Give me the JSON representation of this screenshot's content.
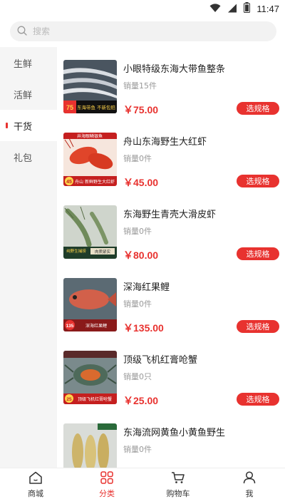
{
  "status": {
    "time": "11:47"
  },
  "search": {
    "placeholder": "搜索"
  },
  "sidebar": {
    "items": [
      {
        "label": "生鲜"
      },
      {
        "label": "活鲜"
      },
      {
        "label": "干货"
      },
      {
        "label": "礼包"
      }
    ],
    "active_index": 2
  },
  "products": [
    {
      "title": "小眼特级东海大带鱼整条",
      "sales": "销量15件",
      "price": "￥75.00",
      "button": "选规格",
      "thumb": {
        "badge": "75",
        "caption": "东海带鱼 不新包赔"
      }
    },
    {
      "title": "舟山东海野生大红虾",
      "sales": "销量0件",
      "price": "￥45.00",
      "button": "选规格",
      "thumb": {
        "badge": "45",
        "caption": "舟山 新鲜野生大红虾",
        "top": "井海眼鳞银鱼"
      }
    },
    {
      "title": "东海野生青壳大滑皮虾",
      "sales": "销量0件",
      "price": "￥80.00",
      "button": "选规格",
      "thumb": {
        "badge": "",
        "caption": "纯野生捕捞",
        "tag": "肉质紧实"
      }
    },
    {
      "title": "深海红果鲤",
      "sales": "销量0件",
      "price": "￥135.00",
      "button": "选规格",
      "thumb": {
        "badge": "135",
        "caption": "深海红果鲤"
      }
    },
    {
      "title": "顶级飞机红膏呛蟹",
      "sales": "销量0只",
      "price": "￥25.00",
      "button": "选规格",
      "thumb": {
        "badge": "25",
        "caption": "顶级飞机红膏呛蟹"
      }
    },
    {
      "title": "东海流网黄鱼小黄鱼野生",
      "sales": "销量0件",
      "price": "",
      "button": "",
      "thumb": {
        "badge": "",
        "caption": ""
      }
    }
  ],
  "bottom_nav": [
    {
      "label": "商城",
      "icon": "home-icon"
    },
    {
      "label": "分类",
      "icon": "category-icon"
    },
    {
      "label": "购物车",
      "icon": "cart-icon"
    },
    {
      "label": "我",
      "icon": "user-icon"
    }
  ],
  "bottom_nav_active": 1,
  "colors": {
    "accent": "#e8322f",
    "sidebar_bg": "#f5f5f5",
    "search_bg": "#f2f2f2"
  }
}
